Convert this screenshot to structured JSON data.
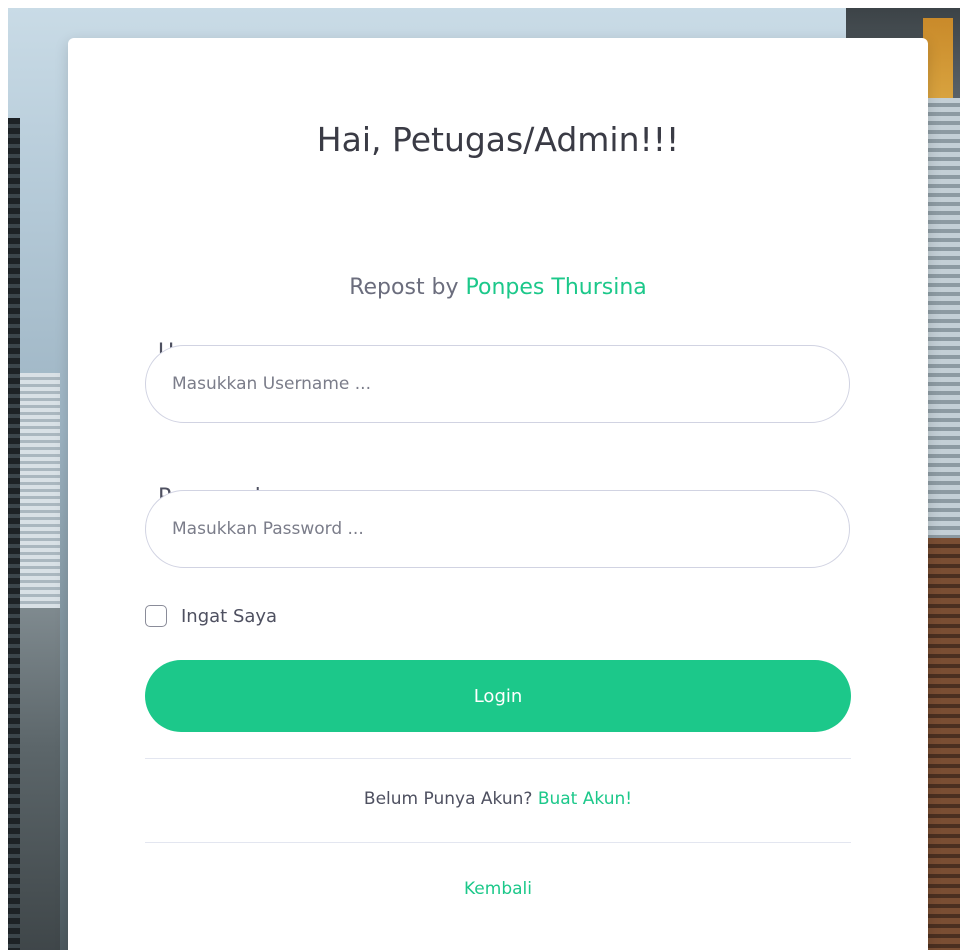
{
  "login": {
    "title": "Hai, Petugas/Admin!!!",
    "subtitle_prefix": "Repost by ",
    "subtitle_link": "Ponpes Thursina",
    "username_label": "Username",
    "username_placeholder": "Masukkan Username ...",
    "username_value": "",
    "password_label": "Password",
    "password_placeholder": "Masukkan Password ...",
    "password_value": "",
    "remember_label": "Ingat Saya",
    "remember_checked": false,
    "login_button": "Login",
    "register_prompt": "Belum Punya Akun? ",
    "register_link": "Buat Akun!",
    "back_link": "Kembali"
  },
  "colors": {
    "accent": "#1cc88a",
    "text": "#4e5060",
    "border": "#d1d3e2"
  }
}
